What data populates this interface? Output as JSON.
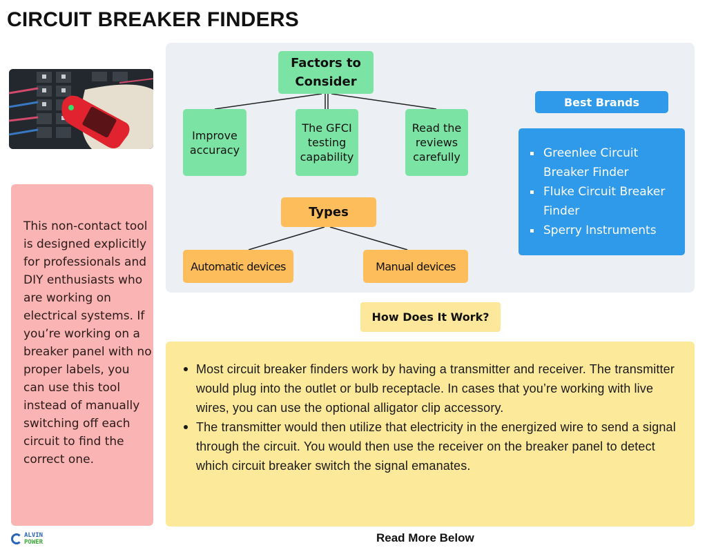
{
  "title": "CIRCUIT BREAKER FINDERS",
  "intro": "This non-contact tool is designed explicitly for professionals and DIY enthusiasts who are working on electrical systems. If you’re working on a breaker panel with no proper labels, you can use this tool instead of manually switching off each circuit to find the correct one.",
  "photo_alt": "Hand holding red circuit breaker finder over breaker panel",
  "factors": {
    "heading": "Factors to Consider",
    "items": [
      "Improve accuracy",
      "The GFCI testing capability",
      "Read the reviews carefully"
    ]
  },
  "types": {
    "heading": "Types",
    "items": [
      "Automatic devices",
      "Manual devices"
    ]
  },
  "brands": {
    "heading": "Best Brands",
    "items": [
      "Greenlee Circuit Breaker Finder",
      "Fluke Circuit Breaker Finder",
      "Sperry Instruments"
    ]
  },
  "how": {
    "heading": "How Does It Work?",
    "items": [
      "Most circuit breaker finders work by having a transmitter and receiver. The transmitter would plug into the outlet or bulb receptacle. In cases that you’re working with live wires, you can use the optional alligator clip accessory.",
      "The transmitter would then utilize that electricity in the energized wire to send a signal through the circuit. You would then use the receiver on the breaker panel to detect which circuit breaker switch the signal emanates."
    ]
  },
  "footer": {
    "read_more": "Read More Below",
    "logo_line1": "ALVIN",
    "logo_line2": "POWER"
  },
  "colors": {
    "green": "#7be3a3",
    "orange": "#fdbd5a",
    "blue": "#2f9ae9",
    "pink": "#fbb4b4",
    "yellow": "#fde99a",
    "panel": "#eceff3"
  }
}
